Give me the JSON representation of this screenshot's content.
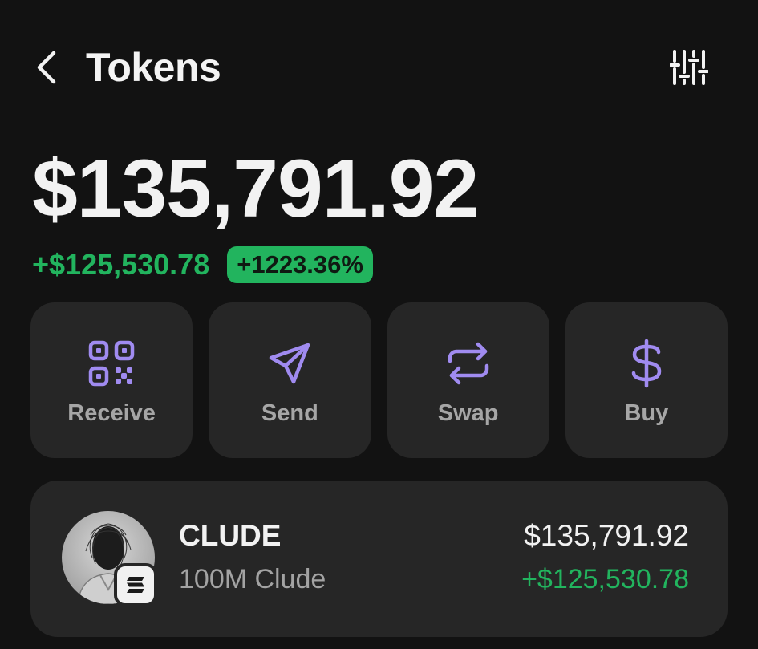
{
  "header": {
    "title": "Tokens",
    "back_icon": "chevron-left-icon",
    "filter_icon": "sliders-icon"
  },
  "balance": {
    "total": "$135,791.92",
    "change_amount": "+$125,530.78",
    "change_percent": "+1223.36%"
  },
  "actions": [
    {
      "label": "Receive",
      "icon": "qr-code-icon"
    },
    {
      "label": "Send",
      "icon": "send-icon"
    },
    {
      "label": "Swap",
      "icon": "swap-icon"
    },
    {
      "label": "Buy",
      "icon": "dollar-icon"
    }
  ],
  "tokens": [
    {
      "name": "CLUDE",
      "amount": "100M Clude",
      "value": "$135,791.92",
      "change": "+$125,530.78"
    }
  ],
  "colors": {
    "background": "#121212",
    "card": "#262626",
    "accent_purple": "#a08bf0",
    "positive_green": "#22b45e",
    "muted_text": "#a6a6a6"
  }
}
